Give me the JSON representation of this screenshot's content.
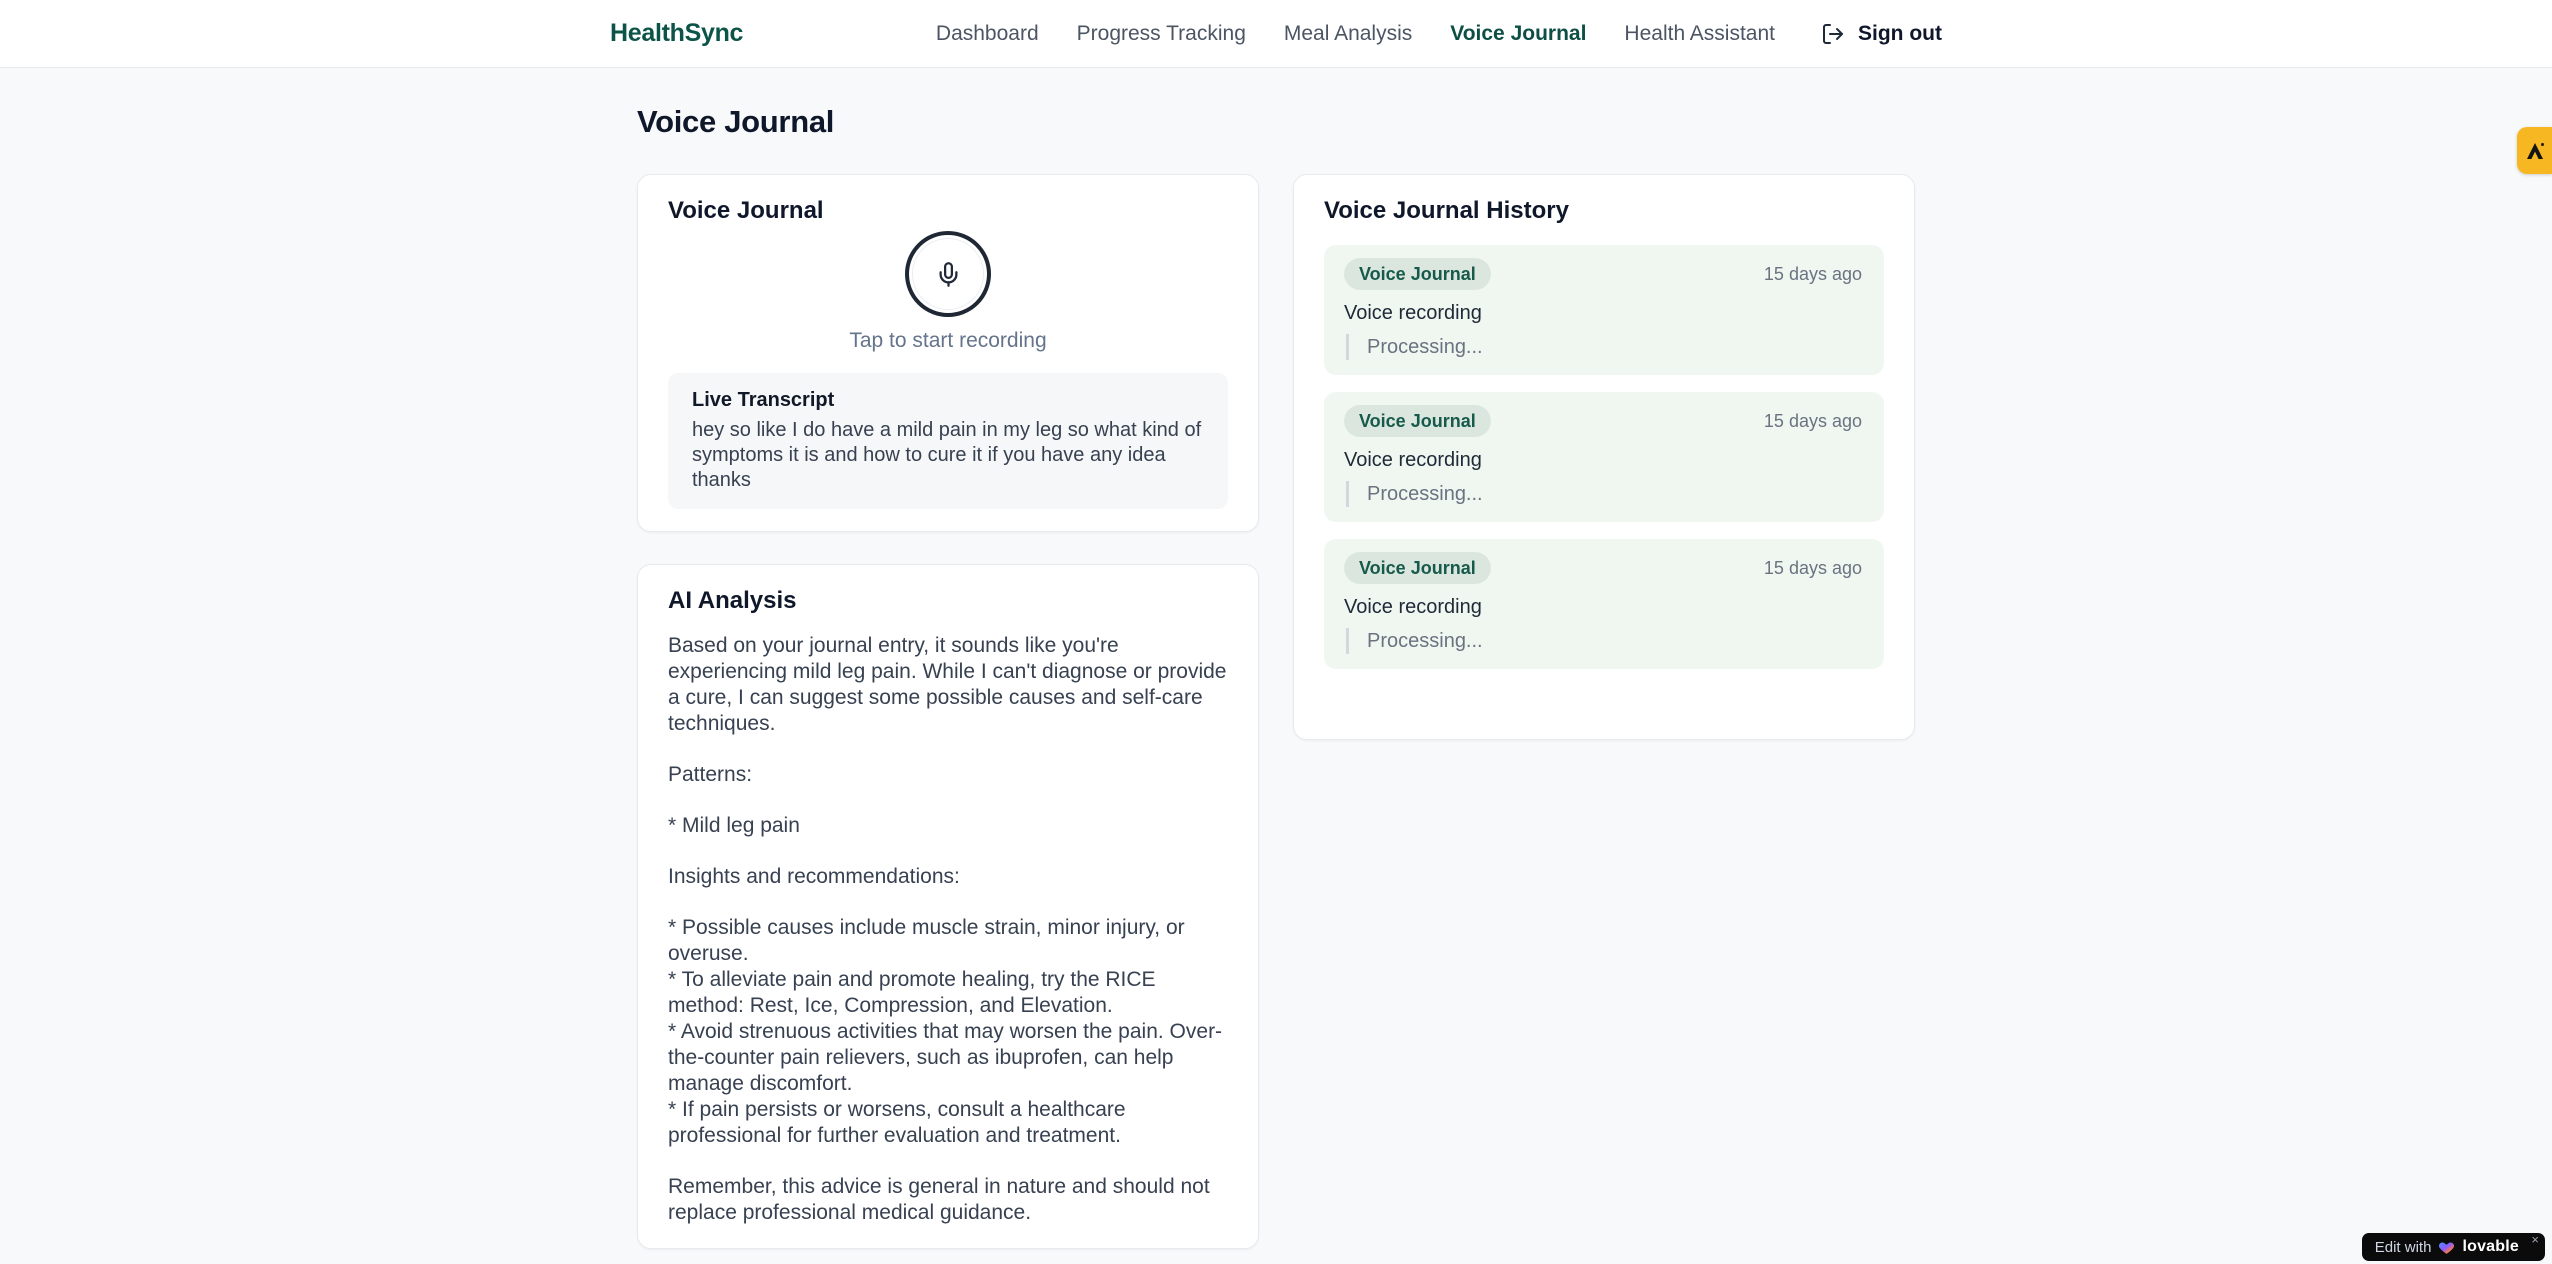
{
  "brand": {
    "name": "HealthSync"
  },
  "nav": {
    "items": [
      {
        "label": "Dashboard",
        "active": false
      },
      {
        "label": "Progress Tracking",
        "active": false
      },
      {
        "label": "Meal Analysis",
        "active": false
      },
      {
        "label": "Voice Journal",
        "active": true
      },
      {
        "label": "Health Assistant",
        "active": false
      }
    ],
    "sign_out": {
      "label": "Sign out"
    }
  },
  "page": {
    "title": "Voice Journal"
  },
  "recorder": {
    "title": "Voice Journal",
    "tap_hint": "Tap to start recording",
    "transcript_heading": "Live Transcript",
    "transcript_text": "hey so like I do have a mild pain in my leg so what kind of symptoms it is and how to cure it if you have any idea thanks"
  },
  "analysis": {
    "title": "AI Analysis",
    "paragraphs": [
      {
        "text": "Based on your journal entry, it sounds like you're experiencing mild leg pain. While I can't diagnose or provide a cure, I can suggest some possible causes and self-care techniques."
      },
      {
        "text": "Patterns:"
      },
      {
        "text": "* Mild leg pain"
      },
      {
        "text": "Insights and recommendations:"
      },
      {
        "text": "* Possible causes include muscle strain, minor injury, or overuse.\n* To alleviate pain and promote healing, try the RICE method: Rest, Ice, Compression, and Elevation.\n* Avoid strenuous activities that may worsen the pain. Over-the-counter pain relievers, such as ibuprofen, can help manage discomfort.\n* If pain persists or worsens, consult a healthcare professional for further evaluation and treatment."
      },
      {
        "text": "Remember, this advice is general in nature and should not replace professional medical guidance."
      }
    ]
  },
  "history": {
    "title": "Voice Journal History",
    "items": [
      {
        "badge": "Voice Journal",
        "time": "15 days ago",
        "label": "Voice recording",
        "status": "Processing..."
      },
      {
        "badge": "Voice Journal",
        "time": "15 days ago",
        "label": "Voice recording",
        "status": "Processing..."
      },
      {
        "badge": "Voice Journal",
        "time": "15 days ago",
        "label": "Voice recording",
        "status": "Processing..."
      }
    ]
  },
  "edit_badge": {
    "prefix": "Edit with",
    "brand": "lovable",
    "close_label": "×"
  },
  "colors": {
    "brand_green": "#0d5448",
    "nav_active": "#0d4f45",
    "history_item_bg": "#f0f7f1",
    "badge_bg": "#dbe7de",
    "badge_text": "#175a4c",
    "amber_tab": "#f7b723",
    "edit_badge_bg": "#0b0b0c"
  }
}
